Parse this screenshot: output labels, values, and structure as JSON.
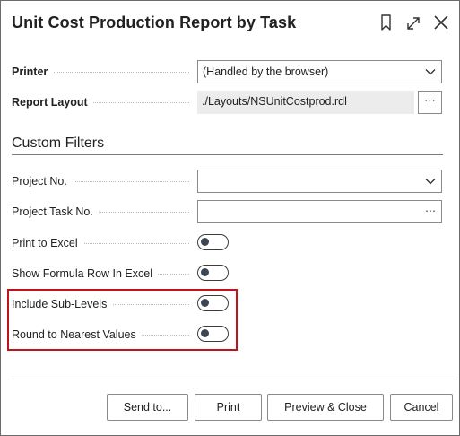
{
  "dialog": {
    "title": "Unit Cost Production Report by Task",
    "icons": {
      "bookmark": "bookmark-icon",
      "expand": "expand-icon",
      "close": "close-icon"
    }
  },
  "printer": {
    "label": "Printer",
    "value": "(Handled by the browser)"
  },
  "report_layout": {
    "label": "Report Layout",
    "value": "./Layouts/NSUnitCostprod.rdl",
    "assist": "⋯"
  },
  "custom_filters": {
    "heading": "Custom Filters",
    "project_no": {
      "label": "Project No.",
      "value": ""
    },
    "project_task_no": {
      "label": "Project Task No.",
      "value": "",
      "assist": "⋯"
    },
    "print_to_excel": {
      "label": "Print to Excel",
      "on": false
    },
    "show_formula_row": {
      "label": "Show Formula Row In Excel",
      "on": false
    },
    "include_sub_levels": {
      "label": "Include Sub-Levels",
      "on": false
    },
    "round_to_nearest": {
      "label": "Round to Nearest Values",
      "on": false
    }
  },
  "highlight_color": "#c0141b",
  "footer": {
    "send_to": "Send to...",
    "print": "Print",
    "preview_close": "Preview & Close",
    "cancel": "Cancel"
  }
}
